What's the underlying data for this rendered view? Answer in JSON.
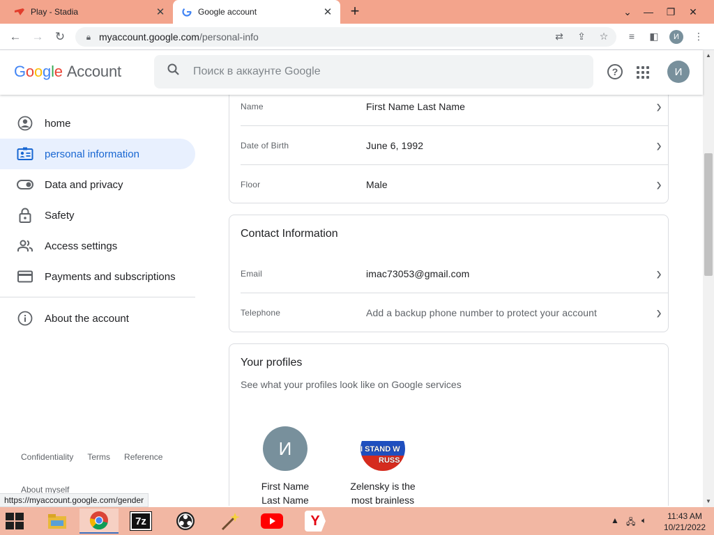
{
  "browser": {
    "tabs": [
      {
        "title": "Play - Stadia",
        "icon": "stadia-icon",
        "active": false
      },
      {
        "title": "Google account",
        "icon": "google-icon",
        "active": true
      }
    ],
    "url_host": "myaccount.google.com",
    "url_path": "/personal-info",
    "avatar_letter": "И",
    "status_url": "https://myaccount.google.com/gender"
  },
  "header": {
    "logo_google": "Google",
    "logo_account": "Account",
    "search_placeholder": "Поиск в аккаунте Google",
    "avatar_letter": "И"
  },
  "sidebar": {
    "items": [
      {
        "label": "home",
        "icon": "account-circle-icon",
        "active": false
      },
      {
        "label": "personal information",
        "icon": "id-card-icon",
        "active": true
      },
      {
        "label": "Data and privacy",
        "icon": "toggle-icon",
        "active": false
      },
      {
        "label": "Safety",
        "icon": "lock-icon",
        "active": false
      },
      {
        "label": "Access settings",
        "icon": "people-icon",
        "active": false
      },
      {
        "label": "Payments and subscriptions",
        "icon": "credit-card-icon",
        "active": false
      },
      {
        "label": "About the account",
        "icon": "info-icon",
        "active": false
      }
    ],
    "footer": {
      "links": [
        "Confidentiality",
        "Terms",
        "Reference"
      ],
      "about_myself": "About myself"
    }
  },
  "basic_info": {
    "rows": [
      {
        "label": "Name",
        "value": "First Name Last Name"
      },
      {
        "label": "Date of Birth",
        "value": "June 6, 1992"
      },
      {
        "label": "Floor",
        "value": "Male"
      }
    ]
  },
  "contact": {
    "title": "Contact Information",
    "rows": [
      {
        "label": "Email",
        "value": "imac73053@gmail.com"
      },
      {
        "label": "Telephone",
        "value": "Add a backup phone number to protect your account"
      }
    ]
  },
  "profiles": {
    "title": "Your profiles",
    "subtitle": "See what your profiles look like on Google services",
    "items": [
      {
        "avatar_letter": "И",
        "name_line1": "First Name",
        "name_line2": "Last Name"
      },
      {
        "avatar_text_1": "I STAND W",
        "avatar_text_2": "RUSS",
        "name_line1": "Zelensky is the",
        "name_line2": "most brainless"
      }
    ]
  },
  "taskbar": {
    "apps": [
      "file-explorer-icon",
      "chrome-icon",
      "7zip-icon",
      "obs-icon",
      "magic-wand-icon",
      "youtube-icon",
      "yandex-icon"
    ],
    "sevenzip_label": "7z",
    "yandex_label": "Y",
    "time": "11:43 AM",
    "date": "10/21/2022"
  },
  "colors": {
    "accent": "#1967d2",
    "active_nav_bg": "#e8f0fe",
    "tabstrip": "#f3a48c",
    "taskbar": "#f2b7a3"
  }
}
